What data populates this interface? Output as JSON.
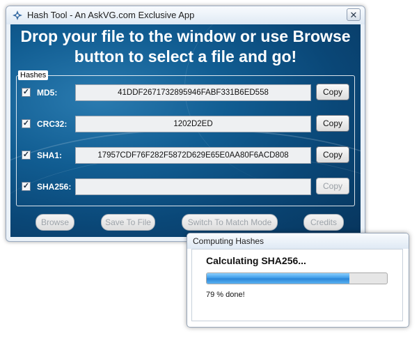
{
  "main_window": {
    "title": "Hash Tool - An AskVG.com Exclusive App",
    "close_glyph": "✕",
    "icon": "app-logo-icon",
    "headline_line1": "Drop your file to the window or use Browse",
    "headline_line2": "button to select a file and go!",
    "hashes_group_label": "Hashes",
    "rows": [
      {
        "label": "MD5:",
        "checked": true,
        "value": "41DDF2671732895946FABF331B6ED558",
        "copy_label": "Copy",
        "copy_enabled": true
      },
      {
        "label": "CRC32:",
        "checked": true,
        "value": "1202D2ED",
        "copy_label": "Copy",
        "copy_enabled": true
      },
      {
        "label": "SHA1:",
        "checked": true,
        "value": "17957CDF76F282F5872D629E65E0AA80F6ACD808",
        "copy_label": "Copy",
        "copy_enabled": true
      },
      {
        "label": "SHA256:",
        "checked": true,
        "value": "",
        "copy_label": "Copy",
        "copy_enabled": false
      }
    ],
    "buttons": {
      "browse": "Browse",
      "save_to_file": "Save To File",
      "switch_mode": "Switch To Match Mode",
      "credits": "Credits"
    }
  },
  "progress_dialog": {
    "title": "Computing Hashes",
    "heading": "Calculating SHA256...",
    "progress_fraction": 0.79,
    "status": "79 % done!"
  },
  "colors": {
    "background_blue": "#0a4777",
    "progress_blue": "#3797e6"
  }
}
